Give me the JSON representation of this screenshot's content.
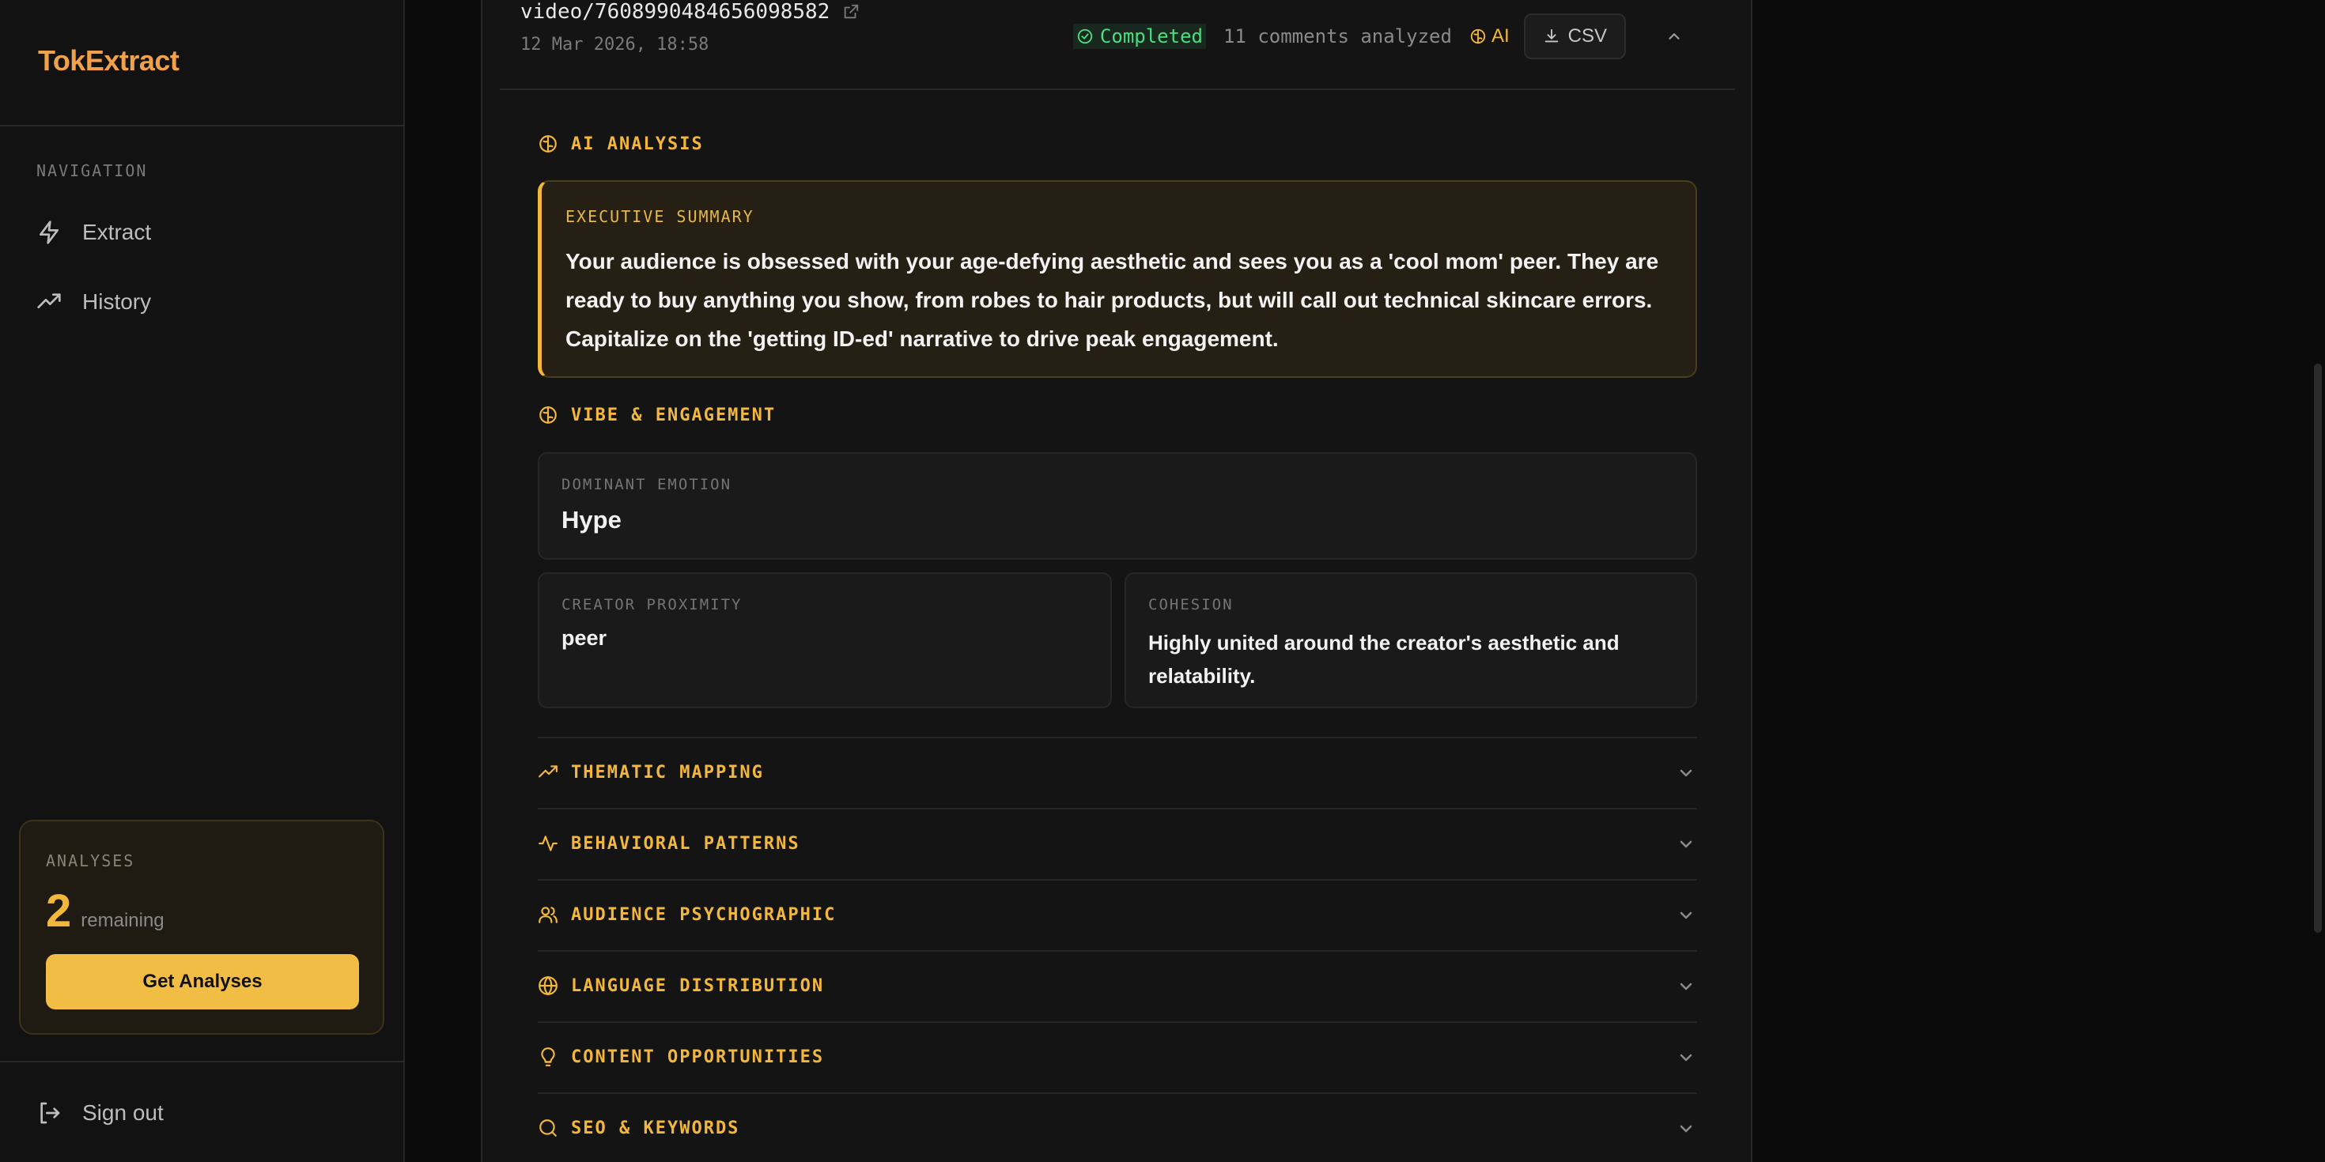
{
  "app": {
    "brand": "TokExtract"
  },
  "sidebar": {
    "nav_title": "NAVIGATION",
    "items": [
      {
        "label": "Extract",
        "icon": "bolt-icon"
      },
      {
        "label": "History",
        "icon": "trending-up-icon"
      }
    ],
    "credits": {
      "label": "ANALYSES",
      "count": "2",
      "suffix": "remaining",
      "button": "Get Analyses"
    },
    "signout": "Sign out"
  },
  "header": {
    "video_id": "video/7608990484656098582",
    "date": "12 Mar 2026, 18:58",
    "status": "Completed",
    "comments": "11 comments analyzed",
    "ai_label": "AI",
    "csv_label": "CSV"
  },
  "analysis": {
    "title": "AI ANALYSIS",
    "executive_summary": {
      "label": "EXECUTIVE SUMMARY",
      "text": "Your audience is obsessed with your age-defying aesthetic and sees you as a 'cool mom' peer. They are ready to buy anything you show, from robes to hair products, but will call out technical skincare errors. Capitalize on the 'getting ID-ed' narrative to drive peak engagement."
    },
    "vibe": {
      "title": "VIBE & ENGAGEMENT",
      "dominant_emotion": {
        "label": "DOMINANT EMOTION",
        "value": "Hype"
      },
      "creator_proximity": {
        "label": "CREATOR PROXIMITY",
        "value": "peer"
      },
      "cohesion": {
        "label": "COHESION",
        "value": "Highly united around the creator's aesthetic and relatability."
      }
    },
    "sections": [
      {
        "label": "THEMATIC MAPPING",
        "icon": "trending-up-icon"
      },
      {
        "label": "BEHAVIORAL PATTERNS",
        "icon": "activity-icon"
      },
      {
        "label": "AUDIENCE PSYCHOGRAPHIC",
        "icon": "users-icon"
      },
      {
        "label": "LANGUAGE DISTRIBUTION",
        "icon": "globe-icon"
      },
      {
        "label": "CONTENT OPPORTUNITIES",
        "icon": "lightbulb-icon"
      },
      {
        "label": "SEO & KEYWORDS",
        "icon": "search-icon"
      }
    ]
  },
  "colors": {
    "accent": "#f2b73b",
    "brand": "#f0a14a",
    "success": "#4ade80",
    "background": "#0b0b0b"
  }
}
